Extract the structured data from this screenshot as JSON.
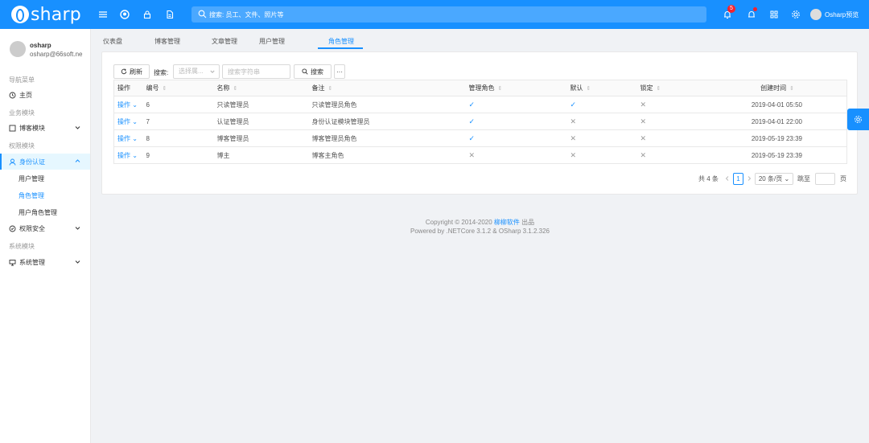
{
  "header": {
    "logo_text": "sharp",
    "search_placeholder": "搜索: 员工、文件、照片等",
    "notification_count": "5",
    "user_label": "Osharp预览"
  },
  "profile": {
    "name": "osharp",
    "email": "osharp@66soft.ne"
  },
  "sidebar": {
    "group_nav": "导航菜单",
    "home": "主页",
    "group_business": "业务模块",
    "blog_module": "博客模块",
    "group_permission": "权限模块",
    "identity": "身份认证",
    "identity_children": [
      "用户管理",
      "角色管理",
      "用户角色管理"
    ],
    "security": "权限安全",
    "group_system": "系统模块",
    "system_manage": "系统管理"
  },
  "tabs": [
    "仪表盘",
    "博客管理",
    "文章管理",
    "用户管理",
    "角色管理"
  ],
  "toolbar": {
    "refresh": "刷新",
    "search_label": "搜索:",
    "select_placeholder": "选择属...",
    "input_placeholder": "搜索字符串",
    "search_button": "搜索",
    "more_button": "···"
  },
  "table": {
    "headers": [
      "操作",
      "编号",
      "名称",
      "备注",
      "管理角色",
      "默认",
      "锁定",
      "创建时间"
    ],
    "rows": [
      {
        "op": "操作",
        "id": "6",
        "name": "只读管理员",
        "remark": "只读管理员角色",
        "admin": "✓",
        "default": "✓",
        "locked": "✕",
        "created": "2019-04-01 05:50"
      },
      {
        "op": "操作",
        "id": "7",
        "name": "认证管理员",
        "remark": "身份认证模块管理员",
        "admin": "✓",
        "default": "✕",
        "locked": "✕",
        "created": "2019-04-01 22:00"
      },
      {
        "op": "操作",
        "id": "8",
        "name": "博客管理员",
        "remark": "博客管理员角色",
        "admin": "✓",
        "default": "✕",
        "locked": "✕",
        "created": "2019-05-19 23:39"
      },
      {
        "op": "操作",
        "id": "9",
        "name": "博主",
        "remark": "博客主角色",
        "admin": "✕",
        "default": "✕",
        "locked": "✕",
        "created": "2019-05-19 23:39"
      }
    ]
  },
  "pagination": {
    "total": "共 4 条",
    "current_page": "1",
    "page_size": "20 条/页",
    "jump_label": "跳至",
    "page_unit": "页"
  },
  "footer": {
    "copyright_prefix": "Copyright © 2014-2020",
    "copyright_link": "柳柳软件",
    "copyright_suffix": "出品",
    "powered": "Powered by .NETCore 3.1.2 & OSharp 3.1.2.326"
  }
}
